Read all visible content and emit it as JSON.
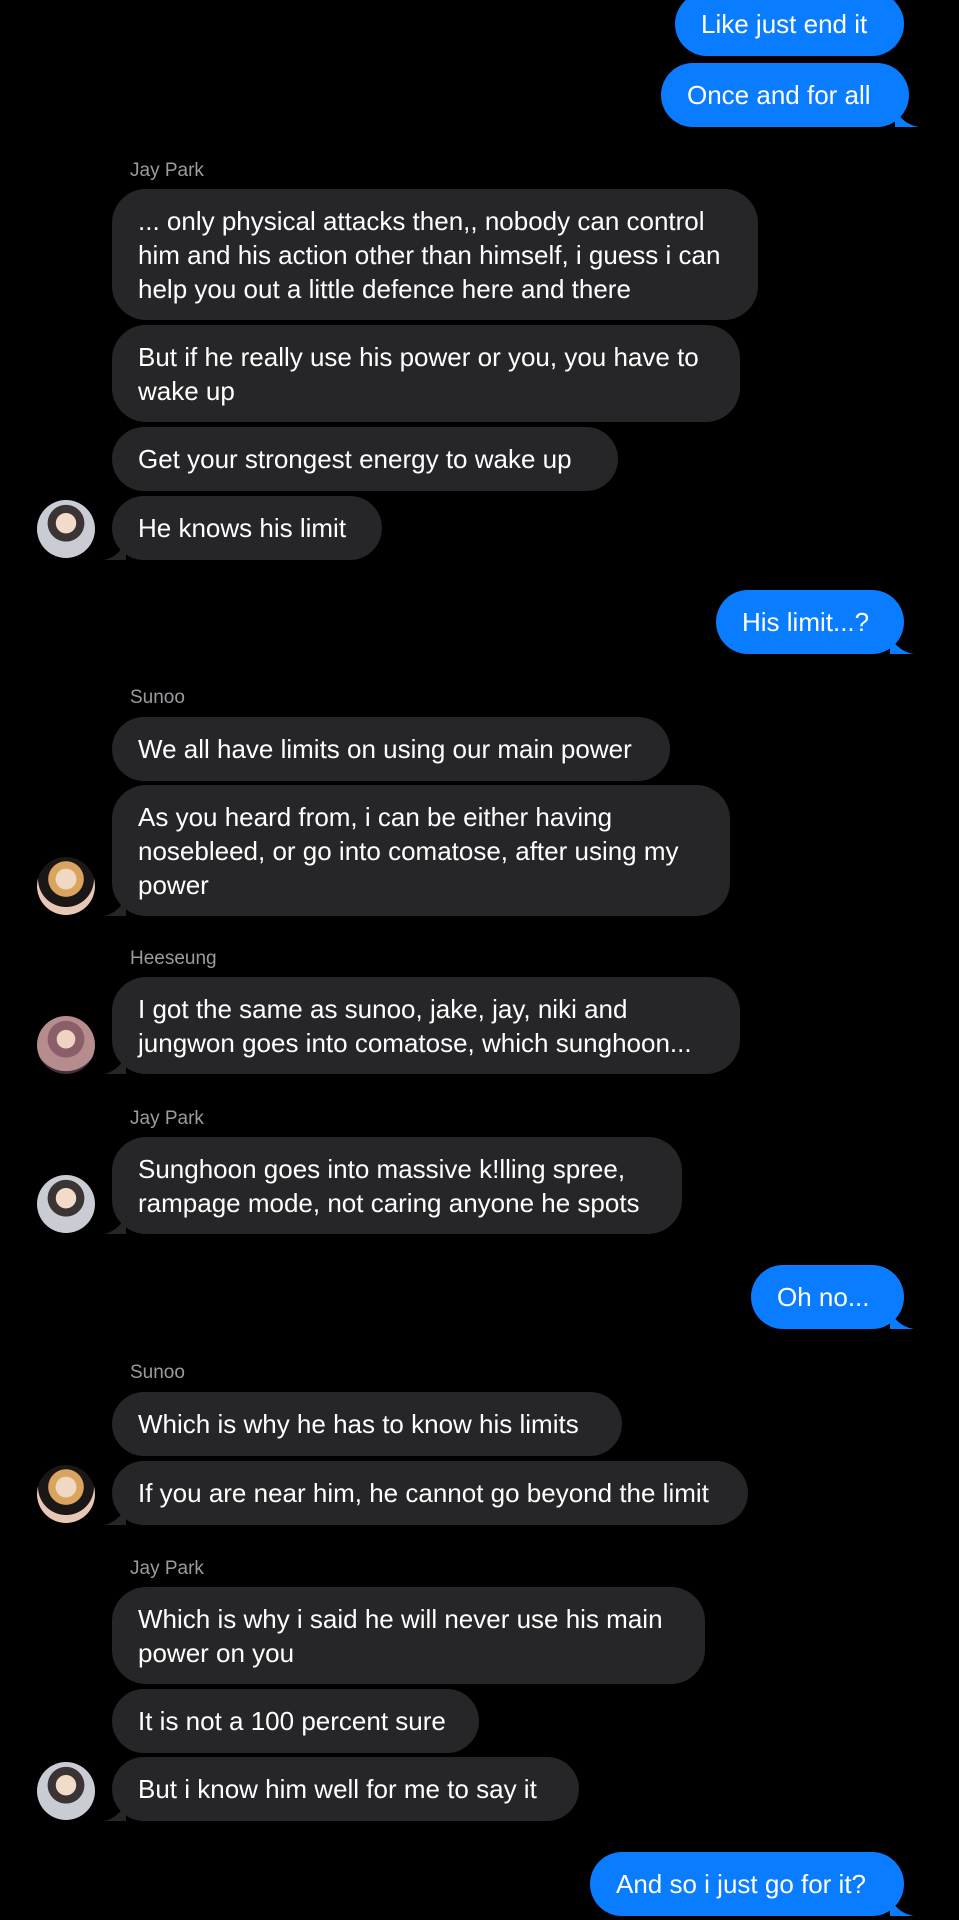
{
  "messages": [
    {
      "type": "out",
      "text": "Like just end it"
    },
    {
      "type": "out",
      "text": "Once and for all"
    },
    {
      "type": "sender",
      "text": "Jay Park"
    },
    {
      "type": "in",
      "text": "... only physical attacks then,, nobody can control him and his action other than himself, i guess i can help you out a little defence here and there"
    },
    {
      "type": "in",
      "text": "But if he really use his power or you, you have to wake up"
    },
    {
      "type": "in",
      "text": "Get your strongest energy to wake up"
    },
    {
      "type": "in",
      "text": "He knows his limit"
    },
    {
      "type": "out",
      "text": "His limit...?"
    },
    {
      "type": "sender",
      "text": "Sunoo"
    },
    {
      "type": "in",
      "text": "We all have limits on using our main power"
    },
    {
      "type": "in",
      "text": "As you heard from, i can be either having nosebleed, or go into comatose, after using my power"
    },
    {
      "type": "sender",
      "text": "Heeseung"
    },
    {
      "type": "in",
      "text": "I got the same as sunoo, jake, jay, niki and jungwon goes into comatose, which sunghoon..."
    },
    {
      "type": "sender",
      "text": "Jay Park"
    },
    {
      "type": "in",
      "text": "Sunghoon goes into massive k!lling spree, rampage mode, not caring anyone he spots"
    },
    {
      "type": "out",
      "text": "Oh no..."
    },
    {
      "type": "sender",
      "text": "Sunoo"
    },
    {
      "type": "in",
      "text": "Which is why he has to know his limits"
    },
    {
      "type": "in",
      "text": "If you are near him, he cannot go beyond the limit"
    },
    {
      "type": "sender",
      "text": "Jay Park"
    },
    {
      "type": "in",
      "text": "Which is why i said he will never use his main power on you"
    },
    {
      "type": "in",
      "text": "It is not a 100 percent sure"
    },
    {
      "type": "in",
      "text": "But i know him well for me to say it"
    },
    {
      "type": "out",
      "text": "And so i just go for it?"
    }
  ],
  "avatars": [
    {
      "contact": "Jay Park",
      "icon": "jay-park-avatar"
    },
    {
      "contact": "Sunoo",
      "icon": "sunoo-avatar"
    },
    {
      "contact": "Heeseung",
      "icon": "heeseung-avatar"
    }
  ],
  "colors": {
    "background": "#000000",
    "incoming_bubble": "#262629",
    "outgoing_bubble": "#0a7cff",
    "sender_label": "#9b9ba1"
  }
}
